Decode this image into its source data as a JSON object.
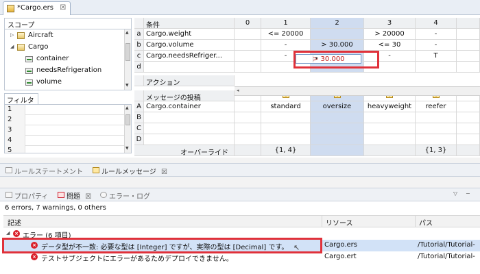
{
  "editor": {
    "tab_title": "*Cargo.ers",
    "tab_close": "☒"
  },
  "scope": {
    "title": "スコープ",
    "items": [
      {
        "label": "Aircraft",
        "twisty": "▷",
        "kind": "table",
        "indent": 0
      },
      {
        "label": "Cargo",
        "twisty": "◢",
        "kind": "table",
        "indent": 0
      },
      {
        "label": "container",
        "twisty": "",
        "kind": "field",
        "indent": 1
      },
      {
        "label": "needsRefrigeration",
        "twisty": "",
        "kind": "field",
        "indent": 1
      },
      {
        "label": "volume",
        "twisty": "",
        "kind": "field",
        "indent": 1
      }
    ]
  },
  "filter": {
    "title": "フィルタ",
    "rows": [
      "1",
      "2",
      "3",
      "4",
      "5"
    ]
  },
  "decision_table": {
    "conditions_header": "条件",
    "column_headers": [
      "0",
      "1",
      "2",
      "3",
      "4"
    ],
    "selected_column": "2",
    "condition_rows": [
      {
        "letter": "a",
        "expr": "Cargo.weight",
        "cells": [
          "",
          "<= 20000",
          "",
          "> 20000",
          "-"
        ]
      },
      {
        "letter": "b",
        "expr": "Cargo.volume",
        "cells": [
          "",
          "-",
          "> 30.000",
          "<= 30",
          "-"
        ]
      },
      {
        "letter": "c",
        "expr": "Cargo.needsRefriger...",
        "cells": [
          "",
          "-",
          "",
          "-",
          "T"
        ]
      },
      {
        "letter": "d",
        "expr": "",
        "cells": [
          "",
          "",
          "",
          "",
          ""
        ]
      }
    ],
    "actions_header": "アクション",
    "post_message_label": "メッセージの投稿",
    "action_rows": [
      {
        "letter": "A",
        "expr": "Cargo.container",
        "cells": [
          "",
          "standard",
          "oversize",
          "heavyweight",
          "reefer"
        ]
      },
      {
        "letter": "B",
        "expr": "",
        "cells": [
          "",
          "",
          "",
          "",
          ""
        ]
      },
      {
        "letter": "C",
        "expr": "",
        "cells": [
          "",
          "",
          "",
          "",
          ""
        ]
      },
      {
        "letter": "D",
        "expr": "",
        "cells": [
          "",
          "",
          "",
          "",
          ""
        ]
      }
    ],
    "override_label": "オーバーライド",
    "override_cells": [
      "",
      "{1, 4}",
      "",
      "",
      "{1, 3}"
    ],
    "dropdown_value": "> 30.000",
    "dropdown_arrow": "▾",
    "scroll_left": "◂"
  },
  "upper_views": {
    "tabs": [
      {
        "label": "ルールステートメント",
        "active": false,
        "close": ""
      },
      {
        "label": "ルールメッセージ",
        "active": true,
        "close": "☒"
      }
    ]
  },
  "lower_views": {
    "tabs": [
      {
        "label": "プロパティ",
        "active": false,
        "close": ""
      },
      {
        "label": "問題",
        "active": true,
        "close": "☒"
      },
      {
        "label": "エラー・ログ",
        "active": false,
        "close": ""
      }
    ],
    "view_menu": "▽",
    "minimize": "−"
  },
  "problems": {
    "summary": "6 errors, 7 warnings, 0 others",
    "columns": [
      "記述",
      "リソース",
      "パス"
    ],
    "group": {
      "label": "エラー (6 項目)",
      "twisty": "◢"
    },
    "rows": [
      {
        "description": "データ型が不一致: 必要な型は [Integer] ですが、実際の型は [Decimal] です。",
        "resource": "Cargo.ers",
        "path": "/Tutorial/Tutorial-",
        "selected": true
      },
      {
        "description": "テストサブジェクトにエラーがあるためデプロイできません。",
        "resource": "Cargo.ert",
        "path": "/Tutorial/Tutorial-",
        "selected": false
      }
    ]
  }
}
